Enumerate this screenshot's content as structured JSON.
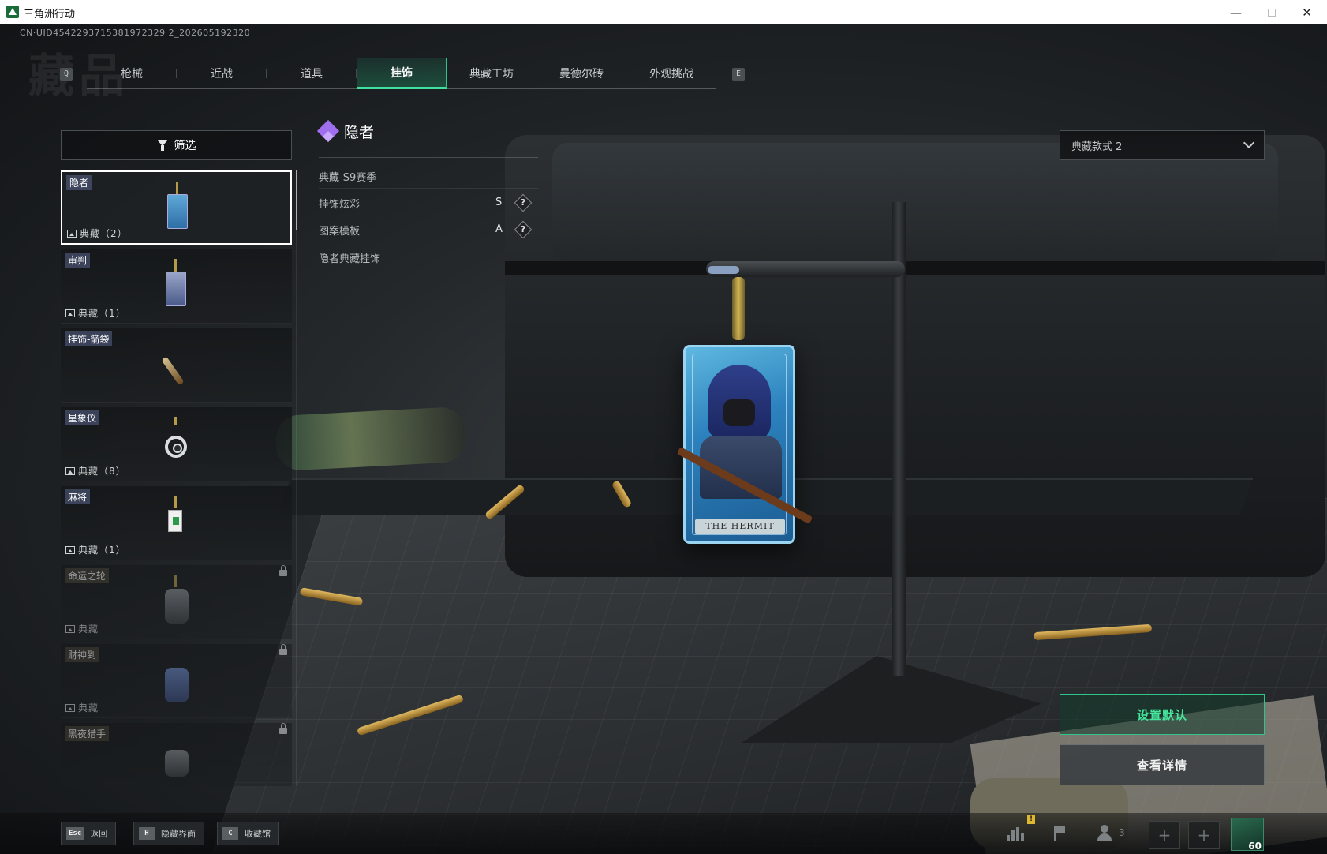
{
  "window": {
    "title": "三角洲行动",
    "minimize": "—",
    "close": "✕"
  },
  "uid": "CN·UID4542293715381972329 2_202605192320",
  "page_watermark": "藏品",
  "tabs": {
    "prev_key": "Q",
    "next_key": "E",
    "items": [
      {
        "label": "枪械"
      },
      {
        "label": "近战"
      },
      {
        "label": "道具"
      },
      {
        "label": "挂饰"
      },
      {
        "label": "典藏工坊"
      },
      {
        "label": "曼德尔砖"
      },
      {
        "label": "外观挑战"
      }
    ],
    "active_index": 3
  },
  "filter": {
    "label": "筛选"
  },
  "list": {
    "items": [
      {
        "name": "隐者",
        "count": "典藏（2）",
        "selected": true,
        "locked": false
      },
      {
        "name": "审判",
        "count": "典藏（1）",
        "selected": false,
        "locked": false
      },
      {
        "name": "挂饰-箭袋",
        "count": "",
        "selected": false,
        "locked": false
      },
      {
        "name": "星象仪",
        "count": "典藏（8）",
        "selected": false,
        "locked": false
      },
      {
        "name": "麻将",
        "count": "典藏（1）",
        "selected": false,
        "locked": false
      },
      {
        "name": "命运之轮",
        "count": "典藏",
        "selected": false,
        "locked": true
      },
      {
        "name": "财神到",
        "count": "典藏",
        "selected": false,
        "locked": true
      },
      {
        "name": "黑夜猎手",
        "count": "",
        "selected": false,
        "locked": true
      }
    ]
  },
  "detail": {
    "title": "隐者",
    "rows": [
      {
        "label": "典藏-S9赛季",
        "grade": ""
      },
      {
        "label": "挂饰炫彩",
        "grade": "S"
      },
      {
        "label": "图案模板",
        "grade": "A"
      },
      {
        "label": "隐者典藏挂饰",
        "grade": ""
      }
    ],
    "help": "?"
  },
  "preview": {
    "nameplate": "THE HERMIT"
  },
  "style_select": {
    "value": "典藏款式 2"
  },
  "actions": {
    "set_default": "设置默认",
    "view_details": "查看详情"
  },
  "bottom_hints": [
    {
      "key": "Esc",
      "label": "返回"
    },
    {
      "key": "H",
      "label": "隐藏界面"
    },
    {
      "key": "C",
      "label": "收藏馆"
    }
  ],
  "status": {
    "notice": "!",
    "friends": "3",
    "slot_plus": "+",
    "level": "60"
  },
  "colors": {
    "accent": "#3fe0a0",
    "rarity_purple": "#9f6ff0"
  }
}
